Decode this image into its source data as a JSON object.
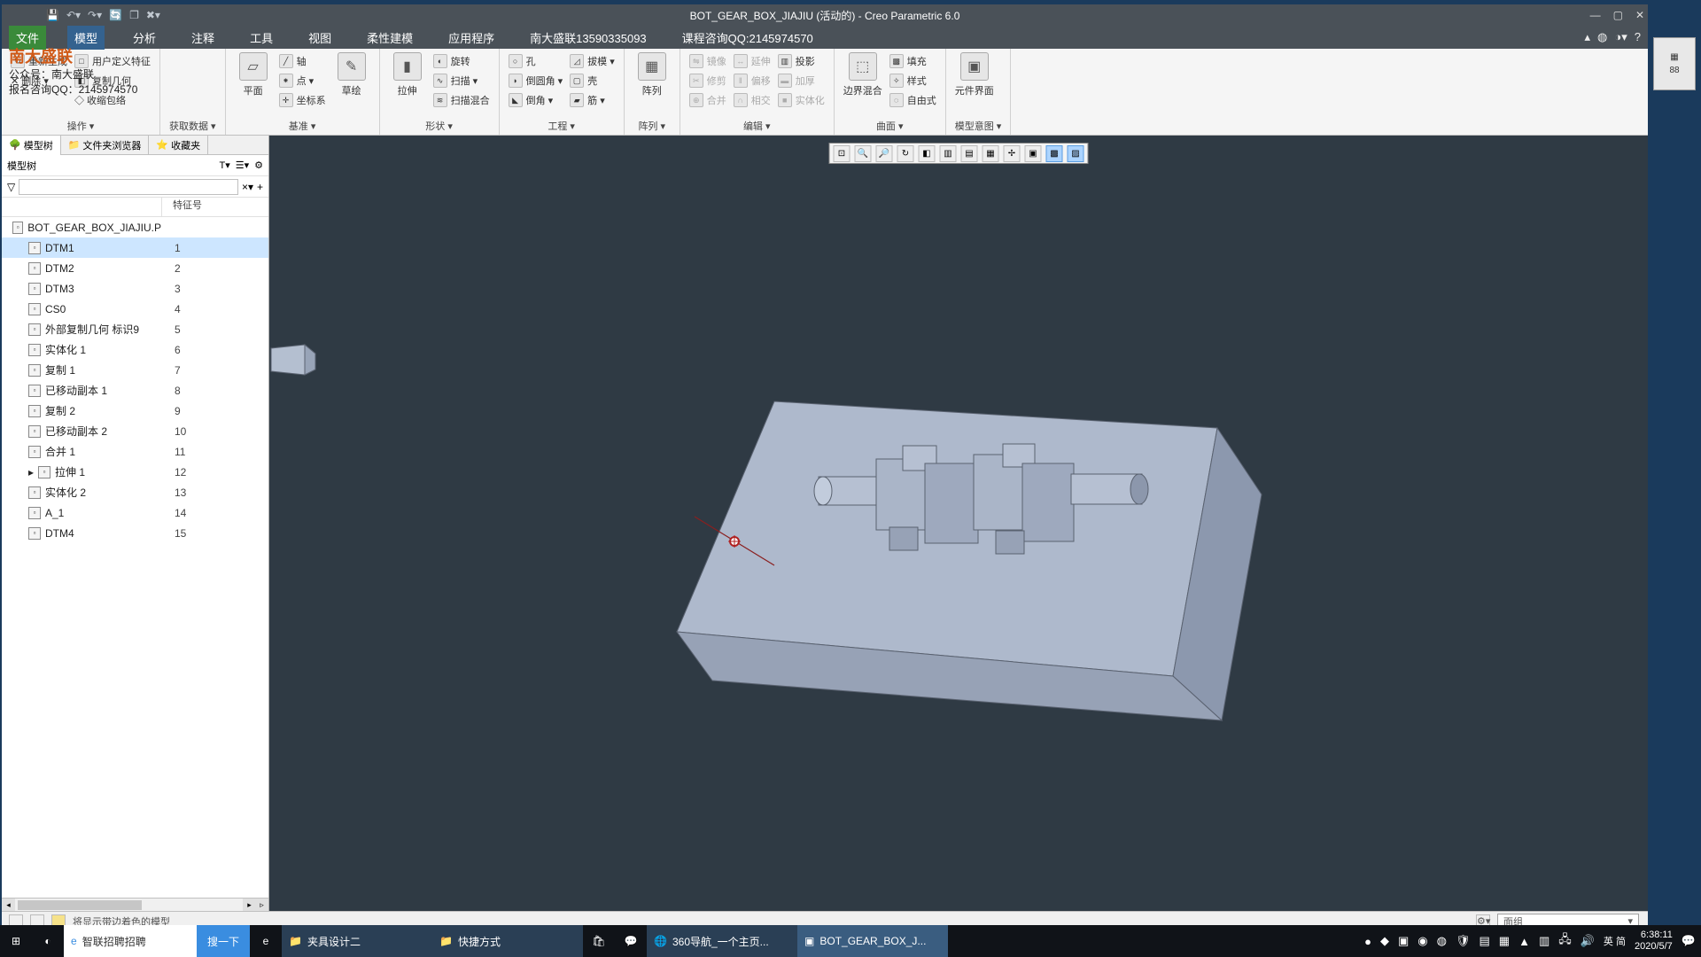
{
  "title": "BOT_GEAR_BOX_JIAJIU (活动的) - Creo Parametric 6.0",
  "avatar": "76",
  "menu": {
    "file": "文件",
    "model": "模型",
    "analysis": "分析",
    "annotate": "注释",
    "tool": "工具",
    "view": "视图",
    "flex": "柔性建模",
    "app": "应用程序",
    "vendor1": "南大盛联13590335093",
    "vendor2": "课程咨询QQ:2145974570"
  },
  "ribbon": {
    "g1": {
      "label": "操作 ▾",
      "regen": "重新生成",
      "udf": "用户定义特征",
      "copygeo": "复制几何",
      "del": "✕ 删除 ▾",
      "wrap": "◇ 收缩包络"
    },
    "g2": {
      "label": "获取数据 ▾"
    },
    "g3": {
      "label": "基准 ▾",
      "plane": "平面",
      "sketch": "草绘",
      "axis": "轴",
      "pt": "点 ▾",
      "cs": "坐标系"
    },
    "g4": {
      "label": "形状 ▾",
      "extrude": "拉伸",
      "revolve": "旋转",
      "sweep": "扫描 ▾",
      "swblend": "扫描混合"
    },
    "g5": {
      "label": "工程 ▾",
      "hole": "孔",
      "round": "倒圆角 ▾",
      "chamfer": "倒角 ▾",
      "draft": "拔模 ▾",
      "shell": "壳",
      "rib": "筋 ▾"
    },
    "g6": {
      "label": "阵列 ▾",
      "pattern": "阵列"
    },
    "g7": {
      "label": "编辑 ▾",
      "mirror": "镜像",
      "trim": "修剪",
      "merge": "合并",
      "extend": "延伸",
      "offset": "偏移",
      "intersect": "相交",
      "thicken": "加厚",
      "solidify": "实体化",
      "project": "投影"
    },
    "g8": {
      "label": "曲面 ▾",
      "blend": "边界混合",
      "fill": "填充",
      "style": "样式",
      "free": "自由式"
    },
    "g9": {
      "label": "模型意图 ▾",
      "compui": "元件界面"
    }
  },
  "side": {
    "tabs": {
      "tree": "模型树",
      "browser": "文件夹浏览器",
      "fav": "收藏夹"
    },
    "treelabel": "模型树",
    "col2": "特征号",
    "root": "BOT_GEAR_BOX_JIAJIU.P",
    "items": [
      {
        "n": "DTM1",
        "f": "1",
        "sel": true
      },
      {
        "n": "DTM2",
        "f": "2"
      },
      {
        "n": "DTM3",
        "f": "3"
      },
      {
        "n": "CS0",
        "f": "4"
      },
      {
        "n": "外部复制几何 标识9",
        "f": "5"
      },
      {
        "n": "实体化 1",
        "f": "6"
      },
      {
        "n": "复制 1",
        "f": "7"
      },
      {
        "n": "已移动副本 1",
        "f": "8"
      },
      {
        "n": "复制 2",
        "f": "9"
      },
      {
        "n": "已移动副本 2",
        "f": "10"
      },
      {
        "n": "合并 1",
        "f": "11"
      },
      {
        "n": "拉伸 1",
        "f": "12",
        "exp": true
      },
      {
        "n": "实体化 2",
        "f": "13"
      },
      {
        "n": "A_1",
        "f": "14"
      },
      {
        "n": "DTM4",
        "f": "15"
      }
    ]
  },
  "status": {
    "msg": "将显示带边着色的模型",
    "combo": "面组"
  },
  "rightStrip": "88",
  "watermark": {
    "l1": "南大盛联",
    "l2": "公众号：南大盛联",
    "l3": "报名咨询QQ：2145974570"
  },
  "taskbar": {
    "search": "智联招聘招聘",
    "searchBtn": "搜一下",
    "t1": "夹具设计二",
    "t2": "快捷方式",
    "t3": "360导航_一个主页...",
    "t4": "BOT_GEAR_BOX_J...",
    "ime": "英 简",
    "time": "6:38:11",
    "date": "2020/5/7"
  }
}
